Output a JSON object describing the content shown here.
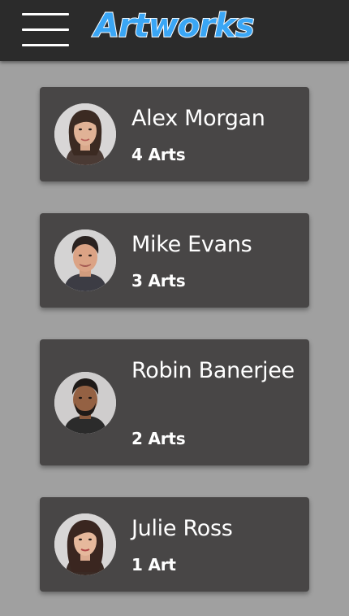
{
  "header": {
    "title": "Artworks",
    "menu_icon": "hamburger-menu-icon",
    "title_color": "#3aa6f5",
    "background": "#2b2b2b"
  },
  "artists": [
    {
      "name": "Alex Morgan",
      "arts": "4 Arts"
    },
    {
      "name": "Mike Evans",
      "arts": "3 Arts"
    },
    {
      "name": "Robin Banerjee",
      "arts": "2 Arts"
    },
    {
      "name": "Julie Ross",
      "arts": "1 Art"
    }
  ],
  "colors": {
    "page_background": "#a0a0a0",
    "card_background": "#484646",
    "text": "#ffffff"
  }
}
